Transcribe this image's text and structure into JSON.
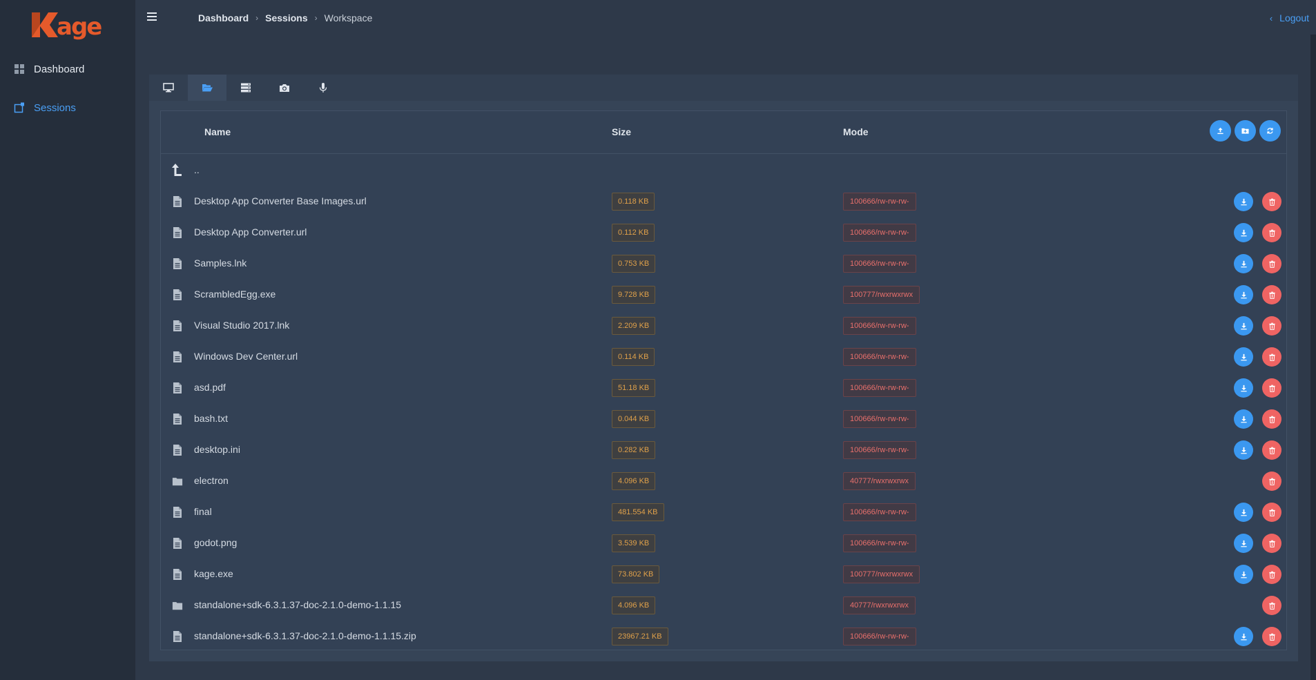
{
  "app": {
    "logo_text": "kage"
  },
  "sidebar": {
    "items": [
      {
        "label": "Dashboard",
        "icon": "grid-icon"
      },
      {
        "label": "Sessions",
        "icon": "session-icon",
        "active": true
      }
    ]
  },
  "topbar": {
    "breadcrumb": [
      "Dashboard",
      "Sessions",
      "Workspace"
    ],
    "logout_label": "Logout"
  },
  "tabs": [
    {
      "icon": "monitor-icon"
    },
    {
      "icon": "folder-open-icon",
      "active": true
    },
    {
      "icon": "server-icon"
    },
    {
      "icon": "camera-icon"
    },
    {
      "icon": "microphone-icon"
    }
  ],
  "table": {
    "headers": {
      "name": "Name",
      "size": "Size",
      "mode": "Mode"
    },
    "parent_label": "..",
    "rows": [
      {
        "name": "Desktop App Converter Base Images.url",
        "size": "0.118 KB",
        "mode": "100666/rw-rw-rw-",
        "type": "file"
      },
      {
        "name": "Desktop App Converter.url",
        "size": "0.112 KB",
        "mode": "100666/rw-rw-rw-",
        "type": "file"
      },
      {
        "name": "Samples.lnk",
        "size": "0.753 KB",
        "mode": "100666/rw-rw-rw-",
        "type": "file"
      },
      {
        "name": "ScrambledEgg.exe",
        "size": "9.728 KB",
        "mode": "100777/rwxrwxrwx",
        "type": "file"
      },
      {
        "name": "Visual Studio 2017.lnk",
        "size": "2.209 KB",
        "mode": "100666/rw-rw-rw-",
        "type": "file"
      },
      {
        "name": "Windows Dev Center.url",
        "size": "0.114 KB",
        "mode": "100666/rw-rw-rw-",
        "type": "file"
      },
      {
        "name": "asd.pdf",
        "size": "51.18 KB",
        "mode": "100666/rw-rw-rw-",
        "type": "file"
      },
      {
        "name": "bash.txt",
        "size": "0.044 KB",
        "mode": "100666/rw-rw-rw-",
        "type": "file"
      },
      {
        "name": "desktop.ini",
        "size": "0.282 KB",
        "mode": "100666/rw-rw-rw-",
        "type": "file"
      },
      {
        "name": "electron",
        "size": "4.096 KB",
        "mode": "40777/rwxrwxrwx",
        "type": "folder"
      },
      {
        "name": "final",
        "size": "481.554 KB",
        "mode": "100666/rw-rw-rw-",
        "type": "file"
      },
      {
        "name": "godot.png",
        "size": "3.539 KB",
        "mode": "100666/rw-rw-rw-",
        "type": "file"
      },
      {
        "name": "kage.exe",
        "size": "73.802 KB",
        "mode": "100777/rwxrwxrwx",
        "type": "file"
      },
      {
        "name": "standalone+sdk-6.3.1.37-doc-2.1.0-demo-1.1.15",
        "size": "4.096 KB",
        "mode": "40777/rwxrwxrwx",
        "type": "folder"
      },
      {
        "name": "standalone+sdk-6.3.1.37-doc-2.1.0-demo-1.1.15.zip",
        "size": "23967.21 KB",
        "mode": "100666/rw-rw-rw-",
        "type": "file"
      }
    ]
  },
  "colors": {
    "accent": "#3b98f0",
    "danger": "#ef6463",
    "brand": "#e55a2b",
    "size_text": "#e0a14a",
    "mode_text": "#e9706c"
  }
}
